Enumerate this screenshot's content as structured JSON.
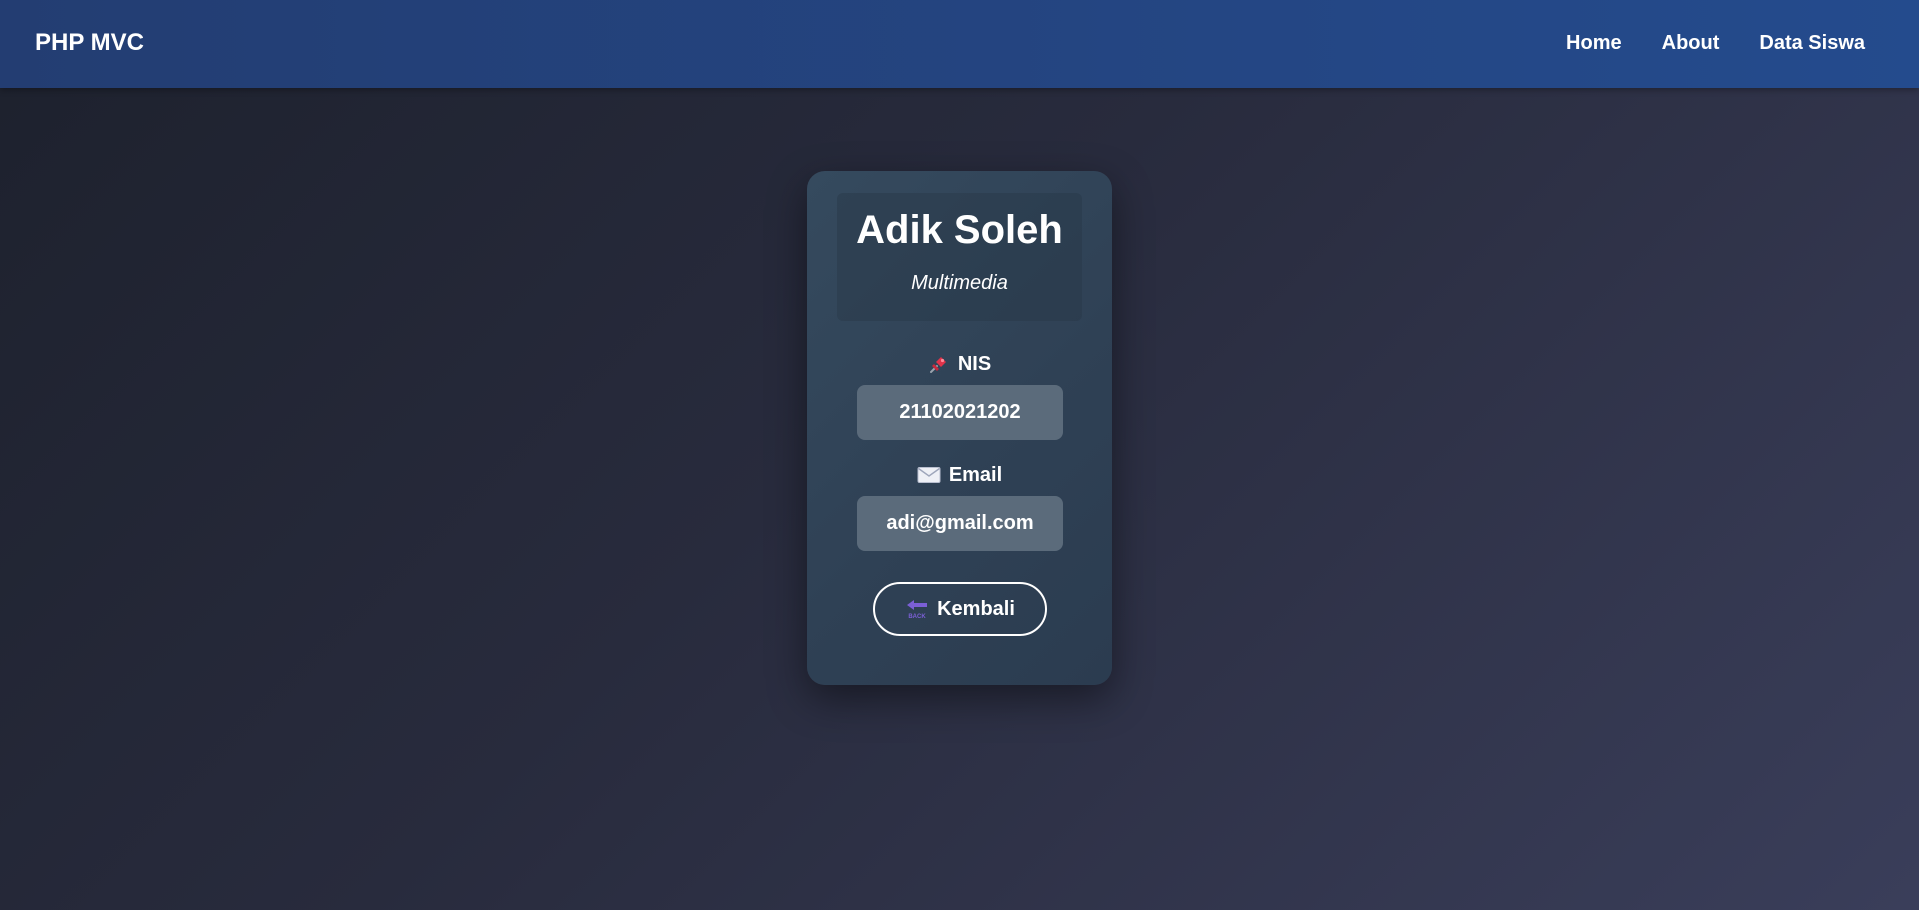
{
  "navbar": {
    "brand": "PHP MVC",
    "links": [
      {
        "label": "Home"
      },
      {
        "label": "About"
      },
      {
        "label": "Data Siswa"
      }
    ]
  },
  "student": {
    "name": "Adik Soleh",
    "major": "Multimedia",
    "nis_label": "NIS",
    "nis": "21102021202",
    "email_label": "Email",
    "email": "adi@gmail.com"
  },
  "actions": {
    "back_label": "Kembali",
    "back_icon_text": "BACK"
  },
  "icons": {
    "nis": "pushpin-icon",
    "email": "envelope-icon",
    "back": "back-arrow-icon"
  },
  "colors": {
    "navbar_start": "#233d72",
    "navbar_end": "#244b8d",
    "card": "#2f4155",
    "value_box": "#5b6b7b",
    "pin": "#e0334a",
    "back_icon": "#7b5fd6"
  }
}
